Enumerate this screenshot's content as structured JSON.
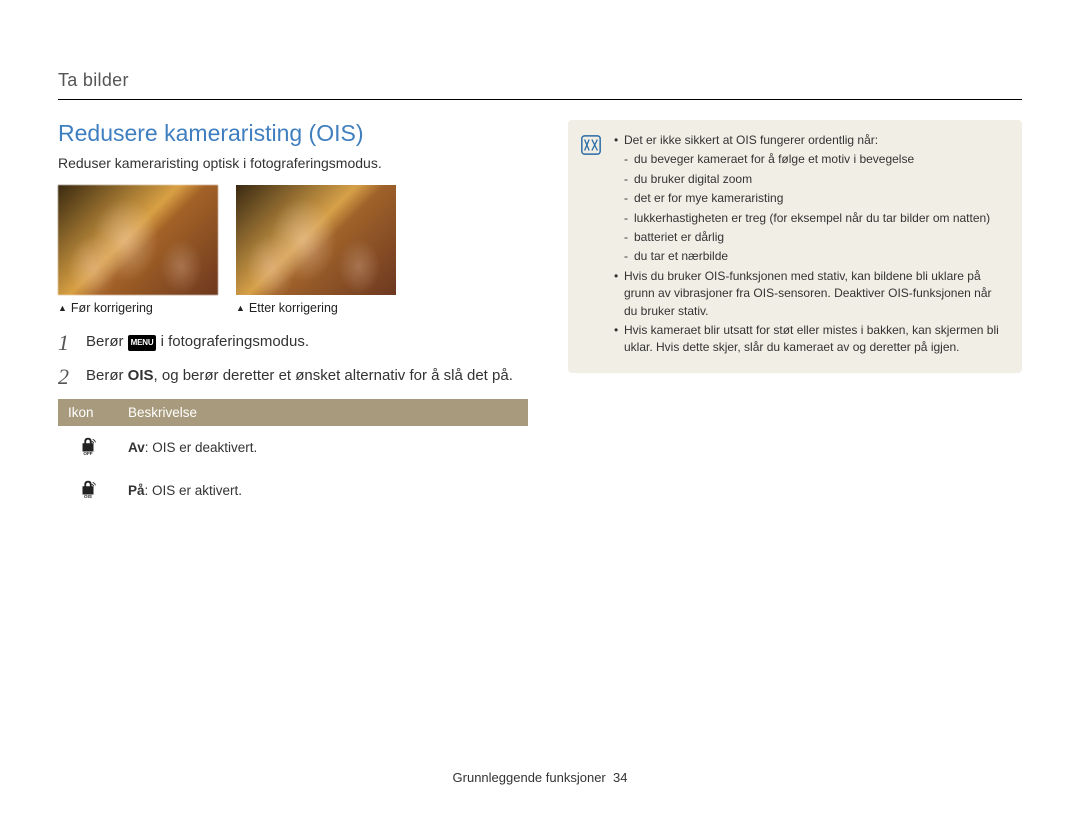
{
  "breadcrumb": "Ta bilder",
  "title": "Redusere kameraristing (OIS)",
  "subtitle": "Reduser kameraristing optisk i fotograferingsmodus.",
  "captions": {
    "before": "Før korrigering",
    "after": "Etter korrigering"
  },
  "steps": [
    {
      "num": "1",
      "pre": "Berør ",
      "badge": "MENU",
      "post": " i fotograferingsmodus."
    },
    {
      "num": "2",
      "pre": "Berør ",
      "bold": "OIS",
      "post": ", og berør deretter et ønsket alternativ for å slå det på."
    }
  ],
  "table": {
    "headers": [
      "Ikon",
      "Beskrivelse"
    ],
    "rows": [
      {
        "icon": "ois-off-icon",
        "label_bold": "Av",
        "label_rest": ": OIS er deaktivert."
      },
      {
        "icon": "ois-on-icon",
        "label_bold": "På",
        "label_rest": ": OIS er aktivert."
      }
    ]
  },
  "note": {
    "items": [
      {
        "text": "Det er ikke sikkert at OIS fungerer ordentlig når:",
        "sub": [
          "du beveger kameraet for å følge et motiv i bevegelse",
          "du bruker digital zoom",
          "det er for mye kameraristing",
          "lukkerhastigheten er treg (for eksempel når du tar bilder om natten)",
          "batteriet er dårlig",
          "du tar et nærbilde"
        ]
      },
      {
        "text": "Hvis du bruker OIS-funksjonen med stativ, kan bildene bli uklare på grunn av vibrasjoner fra OIS-sensoren. Deaktiver OIS-funksjonen når du bruker stativ."
      },
      {
        "text": "Hvis kameraet blir utsatt for støt eller mistes i bakken, kan skjermen bli uklar. Hvis dette skjer, slår du kameraet av og deretter på igjen."
      }
    ]
  },
  "footer": {
    "section": "Grunnleggende funksjoner",
    "page": "34"
  }
}
